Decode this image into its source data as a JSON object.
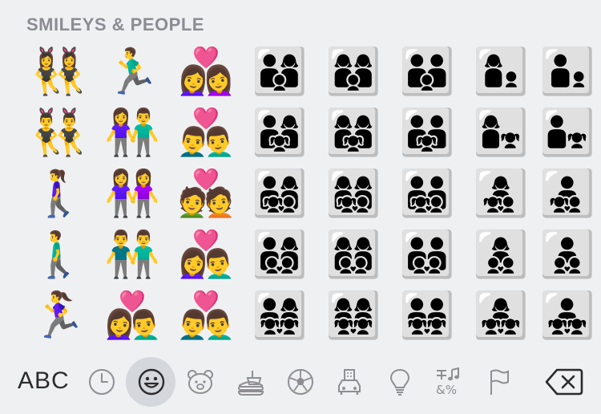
{
  "section_title": "SMILEYS & PEOPLE",
  "grid": [
    [
      "👯‍♀️",
      "🏃‍♂️",
      "👩‍❤️‍👩",
      "👨‍👩‍👦",
      "👩‍👩‍👦",
      "👨‍👨‍👦",
      "👩‍👦",
      "👨‍👦"
    ],
    [
      "👯‍♂️",
      "👫",
      "👨‍❤️‍👨",
      "👨‍👩‍👧",
      "👩‍👩‍👧",
      "👨‍👨‍👧",
      "👩‍👧",
      "👨‍👧"
    ],
    [
      "🚶‍♀️",
      "👭",
      "💑",
      "👨‍👩‍👧‍👦",
      "👩‍👩‍👧‍👦",
      "👨‍👨‍👧‍👦",
      "👩‍👧‍👦",
      "👨‍👧‍👦"
    ],
    [
      "🚶‍♂️",
      "👬",
      "👩‍❤️‍👨",
      "👨‍👩‍👦‍👦",
      "👩‍👩‍👦‍👦",
      "👨‍👨‍👦‍👦",
      "👩‍👦‍👦",
      "👨‍👦‍👦"
    ],
    [
      "🏃‍♀️",
      "👩‍❤️‍👨",
      "👨‍❤️‍👨",
      "👨‍👩‍👧‍👧",
      "👩‍👩‍👧‍👧",
      "👨‍👨‍👧‍👧",
      "👩‍👧‍👧",
      "👨‍👧‍👧"
    ]
  ],
  "keyboard": {
    "abc_label": "ABC",
    "categories": [
      "clock-icon",
      "smiley-icon",
      "bear-icon",
      "food-icon",
      "ball-icon",
      "car-icon",
      "lightbulb-icon",
      "symbols-icon",
      "flag-icon"
    ],
    "active_category": "smiley-icon",
    "delete_icon": "delete-icon"
  },
  "colors": {
    "background": "#eff0f2",
    "section_title": "#8a8d93",
    "icon_gray": "#8e8e93",
    "active_pill": "#d4d7dc"
  }
}
